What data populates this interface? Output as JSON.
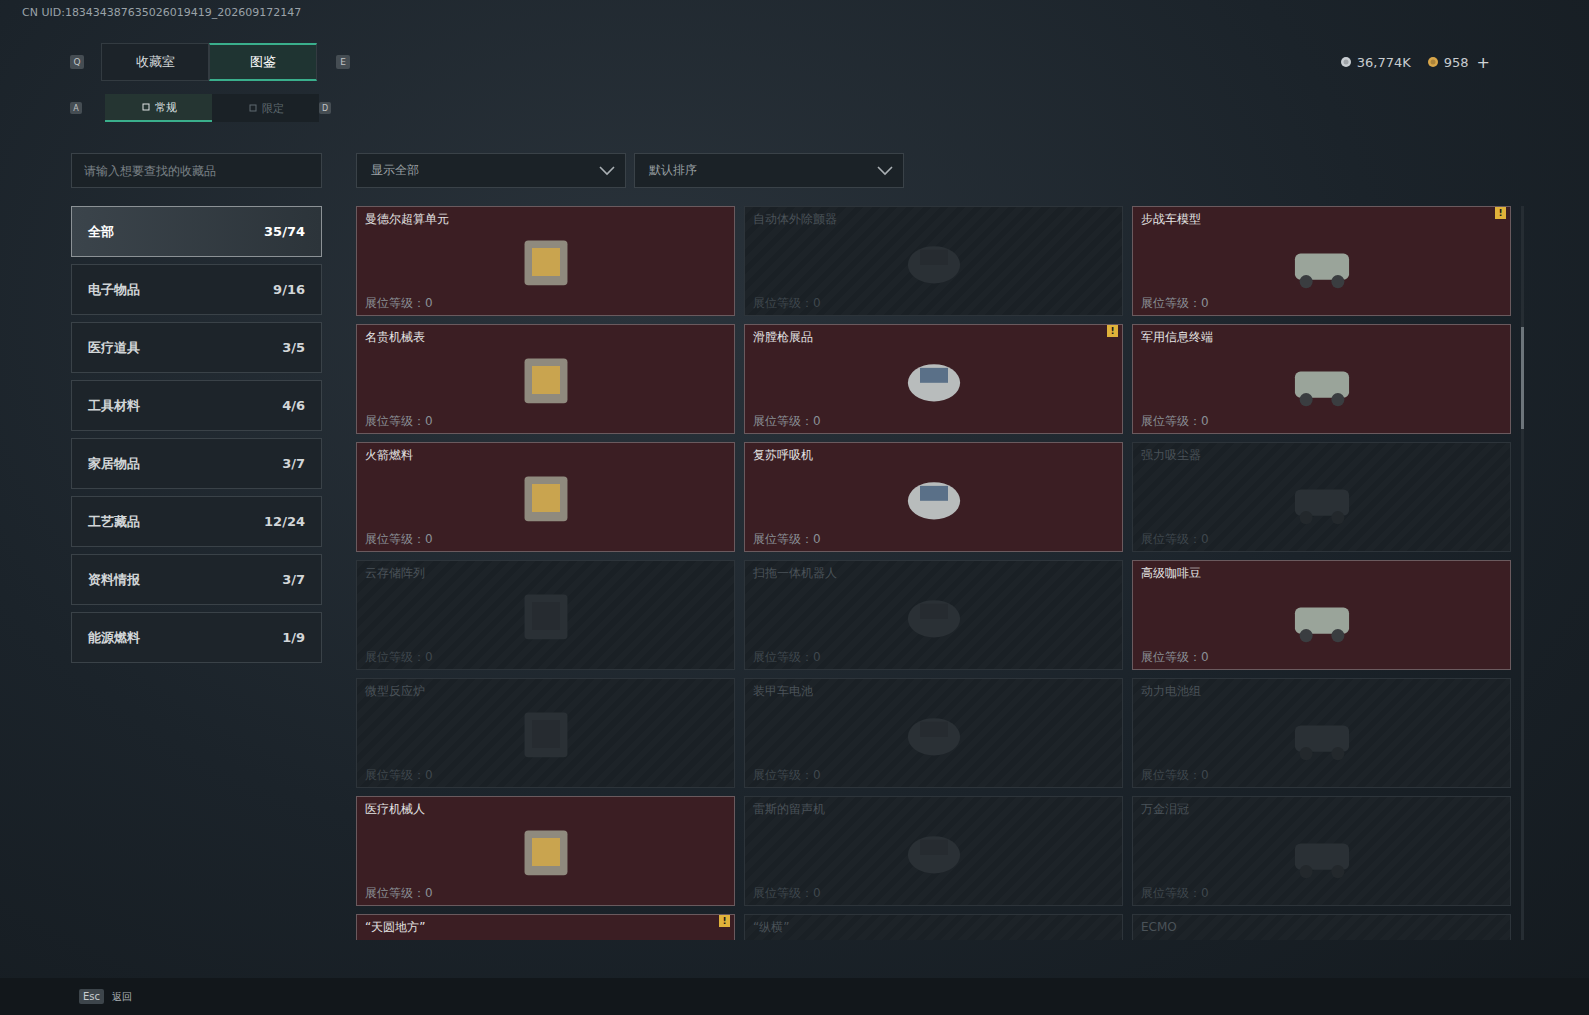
{
  "uid": "CN UID:183434387635026019419_202609172147",
  "currency": [
    {
      "amount": "36,774K",
      "color": "#c9ced2"
    },
    {
      "amount": "958",
      "color": "#d8a64a"
    }
  ],
  "currency_add": "+",
  "tabs": {
    "prev_key": "Q",
    "next_key": "E",
    "items": [
      {
        "label": "收藏室",
        "selected": false
      },
      {
        "label": "图鉴",
        "selected": true
      }
    ]
  },
  "subtabs": {
    "prev_key": "A",
    "next_key": "D",
    "items": [
      {
        "label": "常规",
        "selected": true
      },
      {
        "label": "限定",
        "selected": false
      }
    ]
  },
  "search": {
    "placeholder": "请输入想要查找的收藏品"
  },
  "filters": [
    {
      "label": "显示全部"
    },
    {
      "label": "默认排序"
    }
  ],
  "sidebar": {
    "items": [
      {
        "label": "全部",
        "count": "35/74",
        "selected": true
      },
      {
        "label": "电子物品",
        "count": "9/16",
        "selected": false
      },
      {
        "label": "医疗道具",
        "count": "3/5",
        "selected": false
      },
      {
        "label": "工具材料",
        "count": "4/6",
        "selected": false
      },
      {
        "label": "家居物品",
        "count": "3/7",
        "selected": false
      },
      {
        "label": "工艺藏品",
        "count": "12/24",
        "selected": false
      },
      {
        "label": "资料情报",
        "count": "3/7",
        "selected": false
      },
      {
        "label": "能源燃料",
        "count": "1/9",
        "selected": false
      }
    ]
  },
  "level_label": "展位等级：",
  "items": [
    {
      "name": "曼德尔超算单元",
      "owned": true,
      "level": "0",
      "badge": null
    },
    {
      "name": "自动体外除颤器",
      "owned": false,
      "level": "0",
      "badge": null
    },
    {
      "name": "步战车模型",
      "owned": true,
      "level": "0",
      "badge": "!"
    },
    {
      "name": "名贵机械表",
      "owned": true,
      "level": "0",
      "badge": null
    },
    {
      "name": "滑膛枪展品",
      "owned": true,
      "level": "0",
      "badge": "!"
    },
    {
      "name": "军用信息终端",
      "owned": true,
      "level": "0",
      "badge": null
    },
    {
      "name": "火箭燃料",
      "owned": true,
      "level": "0",
      "badge": null
    },
    {
      "name": "复苏呼吸机",
      "owned": true,
      "level": "0",
      "badge": null
    },
    {
      "name": "强力吸尘器",
      "owned": false,
      "level": "0",
      "badge": null
    },
    {
      "name": "云存储阵列",
      "owned": false,
      "level": "0",
      "badge": null
    },
    {
      "name": "扫拖一体机器人",
      "owned": false,
      "level": "0",
      "badge": null
    },
    {
      "name": "高级咖啡豆",
      "owned": true,
      "level": "0",
      "badge": null
    },
    {
      "name": "微型反应炉",
      "owned": false,
      "level": "0",
      "badge": null
    },
    {
      "name": "装甲车电池",
      "owned": false,
      "level": "0",
      "badge": null
    },
    {
      "name": "动力电池组",
      "owned": false,
      "level": "0",
      "badge": null
    },
    {
      "name": "医疗机械人",
      "owned": true,
      "level": "0",
      "badge": null
    },
    {
      "name": "雷斯的留声机",
      "owned": false,
      "level": "0",
      "badge": null
    },
    {
      "name": "万金泪冠",
      "owned": false,
      "level": "0",
      "badge": null
    },
    {
      "name": "“天圆地方”",
      "owned": true,
      "level": null,
      "badge": "!"
    },
    {
      "name": "“纵横”",
      "owned": false,
      "level": null,
      "badge": null
    },
    {
      "name": "ECMO",
      "owned": false,
      "level": null,
      "badge": null
    }
  ],
  "footer": {
    "key": "Esc",
    "label": "返回"
  }
}
